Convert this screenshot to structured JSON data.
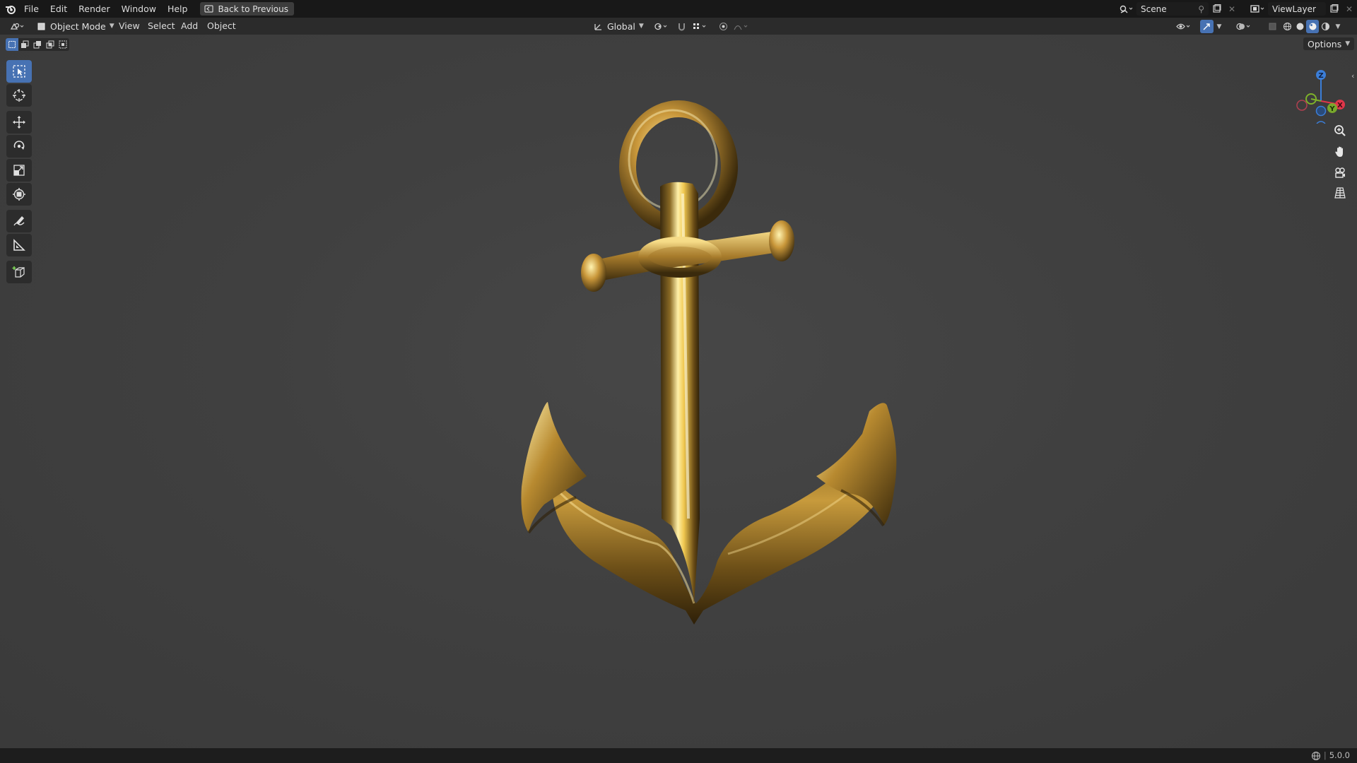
{
  "menubar": {
    "items": [
      "File",
      "Edit",
      "Render",
      "Window",
      "Help"
    ],
    "back_button": "Back to Previous"
  },
  "scene": {
    "label": "Scene"
  },
  "view_layer": {
    "label": "ViewLayer"
  },
  "header": {
    "mode": "Object Mode",
    "menus": [
      "View",
      "Select",
      "Add",
      "Object"
    ],
    "orientation": "Global",
    "options": "Options"
  },
  "gizmo": {
    "x": "X",
    "y": "Y",
    "z": "Z"
  },
  "status": {
    "version": "5.0.0"
  },
  "colors": {
    "accent": "#4772b3",
    "axis_x": "#e0364a",
    "axis_y": "#7eb22a",
    "axis_z": "#3b7ed8"
  }
}
